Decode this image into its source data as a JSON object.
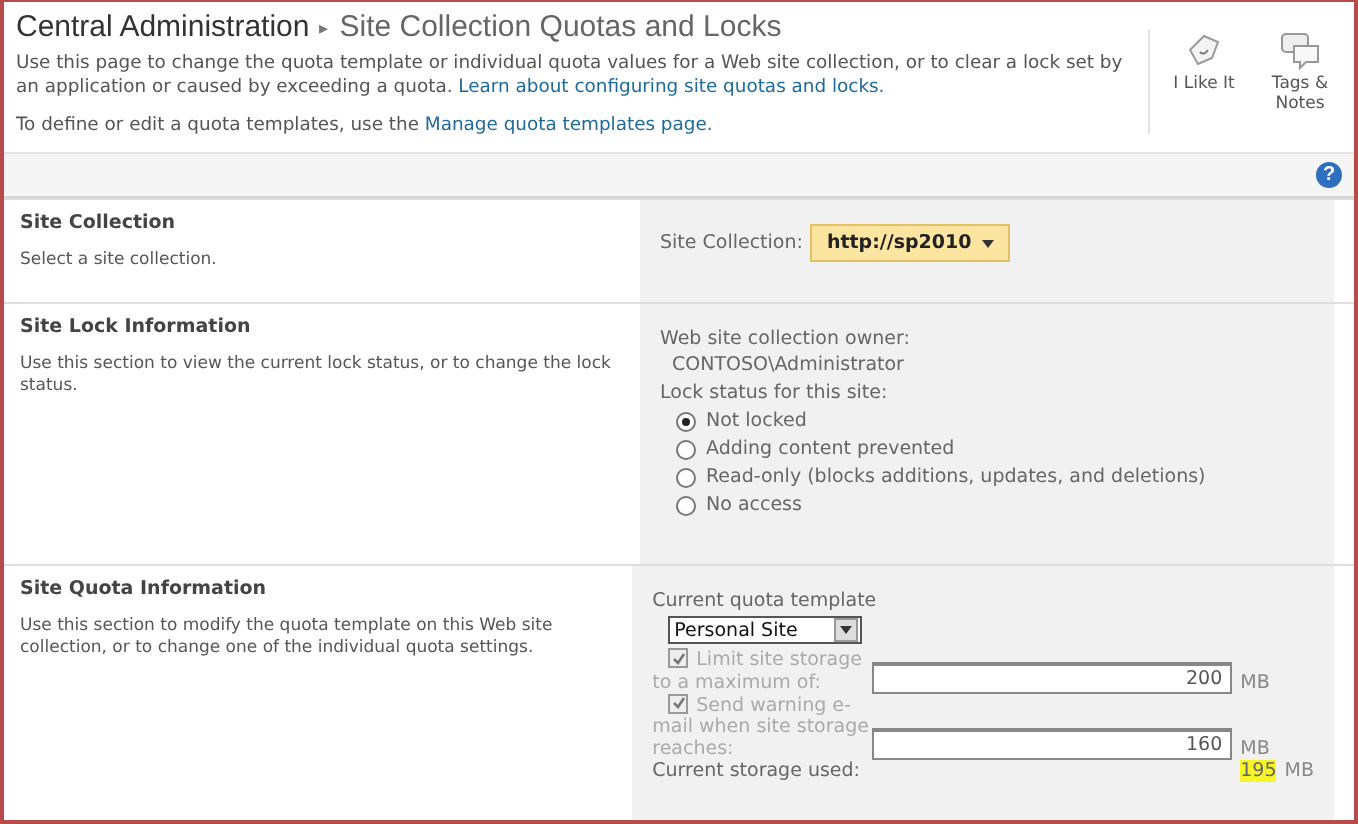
{
  "breadcrumb": {
    "root": "Central Administration",
    "separator": "▸",
    "title": "Site Collection Quotas and Locks"
  },
  "intro": {
    "text": "Use this page to change the quota template or individual quota values for a Web site collection, or to clear a lock set by an application or caused by exceeding a quota.",
    "link": "Learn about configuring site quotas and locks."
  },
  "manage": {
    "text": "To define or edit a quota templates, use the",
    "link": "Manage quota templates page."
  },
  "social": [
    {
      "label": "I Like It",
      "kind": "like"
    },
    {
      "label": "Tags & Notes",
      "kind": "tags"
    }
  ],
  "help": "?",
  "site_collection": {
    "title": "Site Collection",
    "description": "Select a site collection.",
    "label": "Site Collection:",
    "value": "http://sp2010"
  },
  "lock": {
    "title": "Site Lock Information",
    "description": "Use this section to view the current lock status, or to change the lock status.",
    "owner_label": "Web site collection owner:",
    "owner": "CONTOSO\\Administrator",
    "status_label": "Lock status for this site:",
    "options": [
      {
        "label": "Not locked",
        "selected": true
      },
      {
        "label": "Adding content prevented",
        "selected": false
      },
      {
        "label": "Read-only (blocks additions, updates, and deletions)",
        "selected": false
      },
      {
        "label": "No access",
        "selected": false
      }
    ]
  },
  "quota": {
    "title": "Site Quota Information",
    "description": "Use this section to modify the quota template on this Web site collection, or to change one of the individual quota settings.",
    "template_label": "Current quota template",
    "template": "Personal Site",
    "limits": [
      {
        "label": "Limit site storage to a maximum of:",
        "checked": true,
        "disabled": true,
        "value": "200",
        "unit": "MB"
      },
      {
        "label": "Send warning e-mail when site storage reaches:",
        "checked": true,
        "disabled": true,
        "value": "160",
        "unit": "MB"
      }
    ],
    "used_label": "Current storage used:",
    "used": "195",
    "used_unit": "MB"
  }
}
